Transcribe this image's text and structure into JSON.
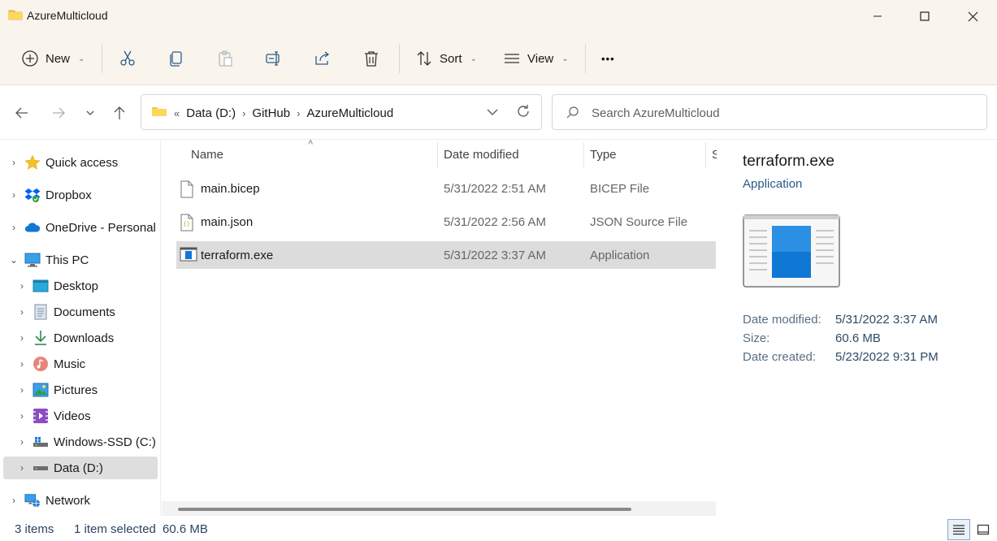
{
  "window": {
    "title": "AzureMulticloud"
  },
  "toolbar": {
    "new_label": "New",
    "sort_label": "Sort",
    "view_label": "View",
    "more_label": "•••"
  },
  "address": {
    "overflow": "«",
    "crumbs": [
      "Data (D:)",
      "GitHub",
      "AzureMulticloud"
    ]
  },
  "search": {
    "placeholder": "Search AzureMulticloud"
  },
  "sidebar": {
    "items": [
      {
        "label": "Quick access",
        "icon": "star-icon",
        "level": 0,
        "expanded": false
      },
      {
        "label": "Dropbox",
        "icon": "dropbox-icon",
        "level": 0,
        "expanded": false
      },
      {
        "label": "OneDrive - Personal",
        "icon": "cloud-icon",
        "level": 0,
        "expanded": false
      },
      {
        "label": "This PC",
        "icon": "monitor-icon",
        "level": 0,
        "expanded": true
      },
      {
        "label": "Desktop",
        "icon": "desktop-icon",
        "level": 1
      },
      {
        "label": "Documents",
        "icon": "documents-icon",
        "level": 1
      },
      {
        "label": "Downloads",
        "icon": "download-icon",
        "level": 1
      },
      {
        "label": "Music",
        "icon": "music-icon",
        "level": 1
      },
      {
        "label": "Pictures",
        "icon": "pictures-icon",
        "level": 1
      },
      {
        "label": "Videos",
        "icon": "videos-icon",
        "level": 1
      },
      {
        "label": "Windows-SSD (C:)",
        "icon": "drive-icon",
        "level": 1
      },
      {
        "label": "Data (D:)",
        "icon": "drive-icon",
        "level": 1,
        "selected": true
      },
      {
        "label": "Network",
        "icon": "network-icon",
        "level": 0,
        "expanded": false
      }
    ]
  },
  "columns": {
    "name": "Name",
    "date": "Date modified",
    "type": "Type",
    "size": "S"
  },
  "files": [
    {
      "name": "main.bicep",
      "date": "5/31/2022 2:51 AM",
      "type": "BICEP File",
      "icon": "file-icon"
    },
    {
      "name": "main.json",
      "date": "5/31/2022 2:56 AM",
      "type": "JSON Source File",
      "icon": "json-file-icon"
    },
    {
      "name": "terraform.exe",
      "date": "5/31/2022 3:37 AM",
      "type": "Application",
      "icon": "application-icon",
      "selected": true
    }
  ],
  "details": {
    "title": "terraform.exe",
    "subtitle": "Application",
    "props": [
      {
        "label": "Date modified:",
        "value": "5/31/2022 3:37 AM"
      },
      {
        "label": "Size:",
        "value": "60.6 MB"
      },
      {
        "label": "Date created:",
        "value": "5/23/2022 9:31 PM"
      }
    ]
  },
  "status": {
    "count": "3 items",
    "selected": "1 item selected",
    "size": "60.6 MB"
  },
  "colors": {
    "accent": "#0067c0",
    "folder": "#f4c542",
    "chrome": "#f9f4ec"
  }
}
